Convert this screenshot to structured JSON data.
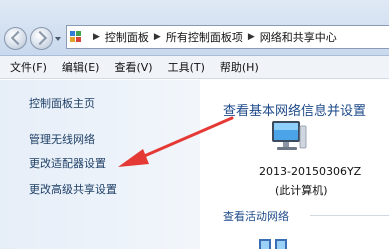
{
  "address_bar": {
    "breadcrumbs": [
      "控制面板",
      "所有控制面板项",
      "网络和共享中心"
    ]
  },
  "menu": {
    "items": [
      "文件(F)",
      "编辑(E)",
      "查看(V)",
      "工具(T)",
      "帮助(H)"
    ]
  },
  "left_pane": {
    "home": "控制面板主页",
    "links": [
      "管理无线网络",
      "更改适配器设置",
      "更改高级共享设置"
    ]
  },
  "main": {
    "title": "查看基本网络信息并设置",
    "computer_name": "2013-20150306YZ",
    "computer_sub": "(此计算机)",
    "active_networks_label": "查看活动网络"
  },
  "annotation": {
    "arrow_color": "#e53935"
  }
}
